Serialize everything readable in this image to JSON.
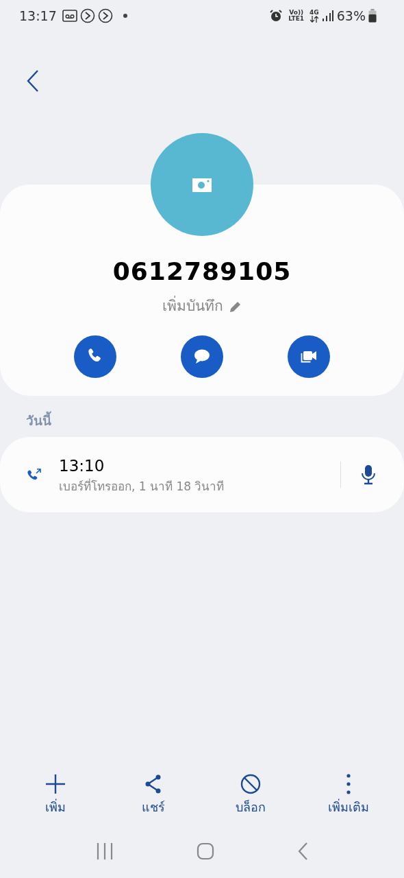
{
  "status_bar": {
    "time": "13:17",
    "volte": "Vo))",
    "lte": "LTE1",
    "network": "4G",
    "battery": "63%"
  },
  "contact": {
    "number": "0612789105",
    "note": "เพิ่มบันทึก",
    "actions": [
      {
        "kind": "call"
      },
      {
        "kind": "message"
      },
      {
        "kind": "video"
      }
    ]
  },
  "section_label": "วันนี้",
  "call_log": [
    {
      "kind": "outgoing",
      "time": "13:10",
      "detail": "เบอร์ที่โทรออก, 1 นาที 18 วินาที"
    }
  ],
  "bottom_actions": [
    {
      "kind": "add",
      "label": "เพิ่ม"
    },
    {
      "kind": "share",
      "label": "แชร์"
    },
    {
      "kind": "block",
      "label": "บล็อก"
    },
    {
      "kind": "more",
      "label": "เพิ่มเติม"
    }
  ]
}
